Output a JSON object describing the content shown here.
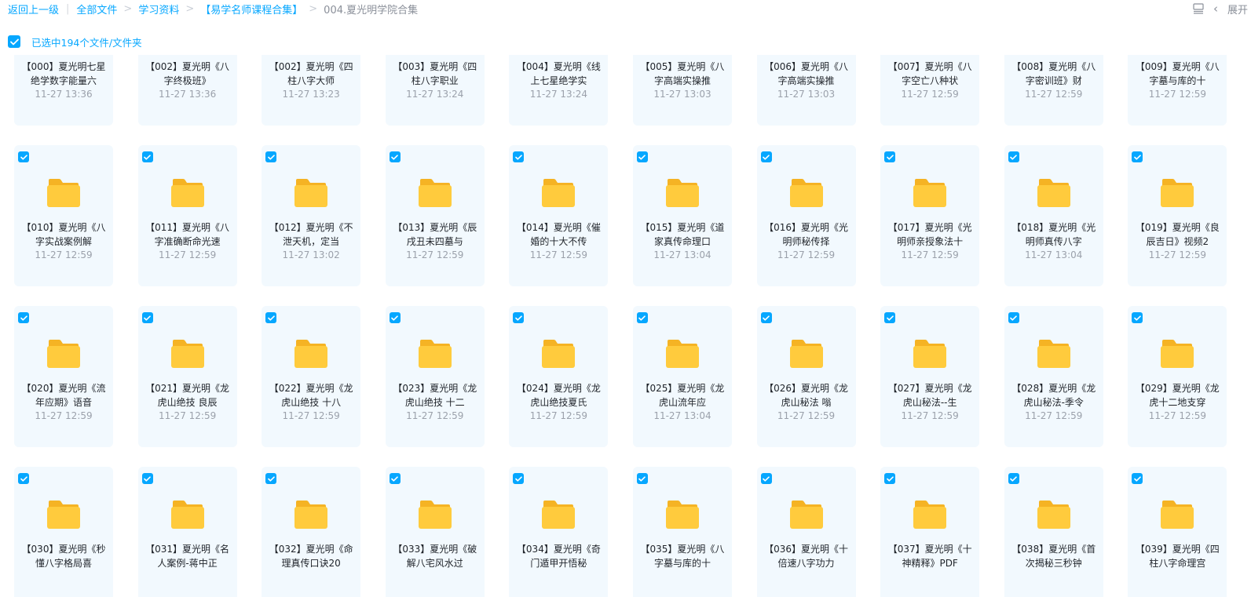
{
  "breadcrumb": {
    "back": "返回上一级",
    "items": [
      "全部文件",
      "学习资料",
      "【易学名师课程合集】"
    ],
    "current": "004.夏光明学院合集"
  },
  "top_right": {
    "expand": "展开",
    "view_icon": "list-view-icon",
    "collapse_icon": "chevron-left-icon"
  },
  "selection": {
    "label": "已选中194个文件/文件夹"
  },
  "colors": {
    "accent": "#06a7ff",
    "card_bg": "#f2f9fe",
    "folder": "#ffcb3d"
  },
  "files": [
    {
      "name": "【000】夏光明七星绝学数字能量六",
      "time": "11-27 13:36"
    },
    {
      "name": "【002】夏光明《八字终极班》",
      "time": "11-27 13:36"
    },
    {
      "name": "【002】夏光明《四柱八字大师",
      "time": "11-27 13:23"
    },
    {
      "name": "【003】夏光明《四柱八字职业",
      "time": "11-27 13:24"
    },
    {
      "name": "【004】夏光明《线上七星绝学实",
      "time": "11-27 13:24"
    },
    {
      "name": "【005】夏光明《八字高端实操推",
      "time": "11-27 13:03"
    },
    {
      "name": "【006】夏光明《八字高端实操推",
      "time": "11-27 13:03"
    },
    {
      "name": "【007】夏光明《八字空亡八种状",
      "time": "11-27 12:59"
    },
    {
      "name": "【008】夏光明《八字密训班》财",
      "time": "11-27 12:59"
    },
    {
      "name": "【009】夏光明《八字墓与库的十",
      "time": "11-27 12:59"
    },
    {
      "name": "【010】夏光明《八字实战案例解",
      "time": "11-27 12:59"
    },
    {
      "name": "【011】夏光明《八字准确断命光速",
      "time": "11-27 12:59"
    },
    {
      "name": "【012】夏光明《不泄天机，定当",
      "time": "11-27 13:02"
    },
    {
      "name": "【013】夏光明《辰戌丑未四墓与",
      "time": "11-27 12:59"
    },
    {
      "name": "【014】夏光明《催婚的十大不传",
      "time": "11-27 12:59"
    },
    {
      "name": "【015】夏光明《道家真传命理口",
      "time": "11-27 13:04"
    },
    {
      "name": "【016】夏光明《光明师秘传择",
      "time": "11-27 12:59"
    },
    {
      "name": "【017】夏光明《光明师亲授象法十",
      "time": "11-27 12:59"
    },
    {
      "name": "【018】夏光明《光明师真传八字",
      "time": "11-27 13:04"
    },
    {
      "name": "【019】夏光明《良辰吉日》视频2",
      "time": "11-27 12:59"
    },
    {
      "name": "【020】夏光明《流年应期》语音",
      "time": "11-27 12:59"
    },
    {
      "name": "【021】夏光明《龙虎山绝技 良辰",
      "time": "11-27 12:59"
    },
    {
      "name": "【022】夏光明《龙虎山绝技 十八",
      "time": "11-27 12:59"
    },
    {
      "name": "【023】夏光明《龙虎山绝技 十二",
      "time": "11-27 12:59"
    },
    {
      "name": "【024】夏光明《龙虎山绝技夏氏",
      "time": "11-27 12:59"
    },
    {
      "name": "【025】夏光明《龙虎山流年应",
      "time": "11-27 13:04"
    },
    {
      "name": "【026】夏光明《龙虎山秘法 嗡",
      "time": "11-27 12:59"
    },
    {
      "name": "【027】夏光明《龙虎山秘法--生",
      "time": "11-27 12:59"
    },
    {
      "name": "【028】夏光明《龙虎山秘法-季令",
      "time": "11-27 12:59"
    },
    {
      "name": "【029】夏光明《龙虎十二地支穿",
      "time": "11-27 12:59"
    },
    {
      "name": "【030】夏光明《秒懂八字格局喜",
      "time": ""
    },
    {
      "name": "【031】夏光明《名人案例-蒋中正",
      "time": ""
    },
    {
      "name": "【032】夏光明《命理真传口诀20",
      "time": ""
    },
    {
      "name": "【033】夏光明《破解八宅风水过",
      "time": ""
    },
    {
      "name": "【034】夏光明《奇门遁甲开悟秘",
      "time": ""
    },
    {
      "name": "【035】夏光明《八字墓与库的十",
      "time": ""
    },
    {
      "name": "【036】夏光明《十倍速八字功力",
      "time": ""
    },
    {
      "name": "【037】夏光明《十神精释》PDF",
      "time": ""
    },
    {
      "name": "【038】夏光明《首次揭秘三秒钟",
      "time": ""
    },
    {
      "name": "【039】夏光明《四柱八字命理宫",
      "time": ""
    }
  ]
}
